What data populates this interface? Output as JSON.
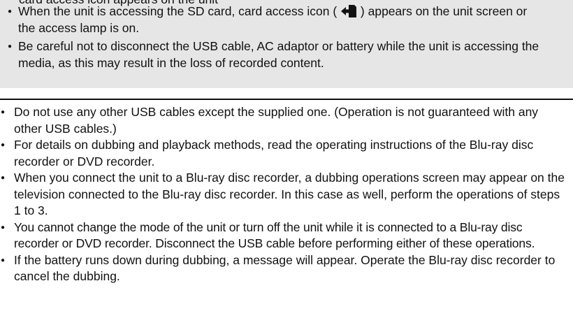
{
  "note_box": {
    "cut_off_line": "card access icon appears on the unit",
    "bullets": {
      "access_before": "When the unit is accessing the SD card, card access icon ( ",
      "access_after": " ) appears on the unit screen or the access lamp is on.",
      "disconnect": "Be careful not to disconnect the USB cable, AC adaptor or battery while the unit is accessing the media, as this may result in the loss of recorded content."
    }
  },
  "notes": [
    "Do not use any other USB cables except the supplied one. (Operation is not guaranteed with any other USB cables.)",
    "For details on dubbing and playback methods, read the operating instructions of the Blu-ray disc recorder or DVD recorder.",
    "When you connect the unit to a Blu-ray disc recorder, a dubbing operations screen may appear on the television connected to the Blu-ray disc recorder. In this case as well, perform the operations of steps 1 to 3.",
    "You cannot change the mode of the unit or turn off the unit while it is connected to a Blu-ray disc recorder or DVD recorder. Disconnect the USB cable before performing either of these operations.",
    "If the battery runs down during dubbing, a message will appear. Operate the Blu-ray disc recorder to cancel the dubbing."
  ],
  "icons": {
    "card_access": "card-access-icon"
  }
}
